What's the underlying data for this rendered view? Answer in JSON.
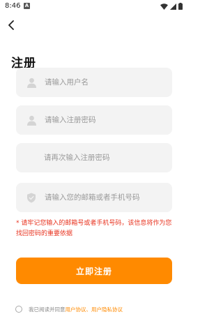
{
  "status_bar": {
    "time": "8:46",
    "notification_letter": "A",
    "icons": [
      "wifi-icon",
      "signal-icon",
      "battery-icon"
    ]
  },
  "header": {
    "back_icon": "chevron-left-icon",
    "title": "注册"
  },
  "form": {
    "username": {
      "icon": "user-icon",
      "placeholder": "请输入用户名",
      "value": ""
    },
    "password": {
      "icon": "user-icon",
      "placeholder": "请输入注册密码",
      "value": ""
    },
    "confirm_password": {
      "placeholder": "请再次输入注册密码",
      "value": ""
    },
    "contact": {
      "icon": "shield-check-icon",
      "placeholder": "请输入您的邮箱或者手机号码",
      "value": ""
    }
  },
  "notice": "* 请牢记您输入的邮箱号或者手机号码，该信息将作为您找回密码的重要依据",
  "register_button": "立即注册",
  "agreement": {
    "prefix": "我已阅读并同意",
    "user_agreement": "用户协议",
    "separator": "、",
    "privacy_agreement": "用户隐私协议"
  },
  "colors": {
    "accent": "#ff8a00",
    "notice": "#e8331f",
    "field_bg": "#f3f3f3",
    "placeholder": "#9a9a9a"
  }
}
